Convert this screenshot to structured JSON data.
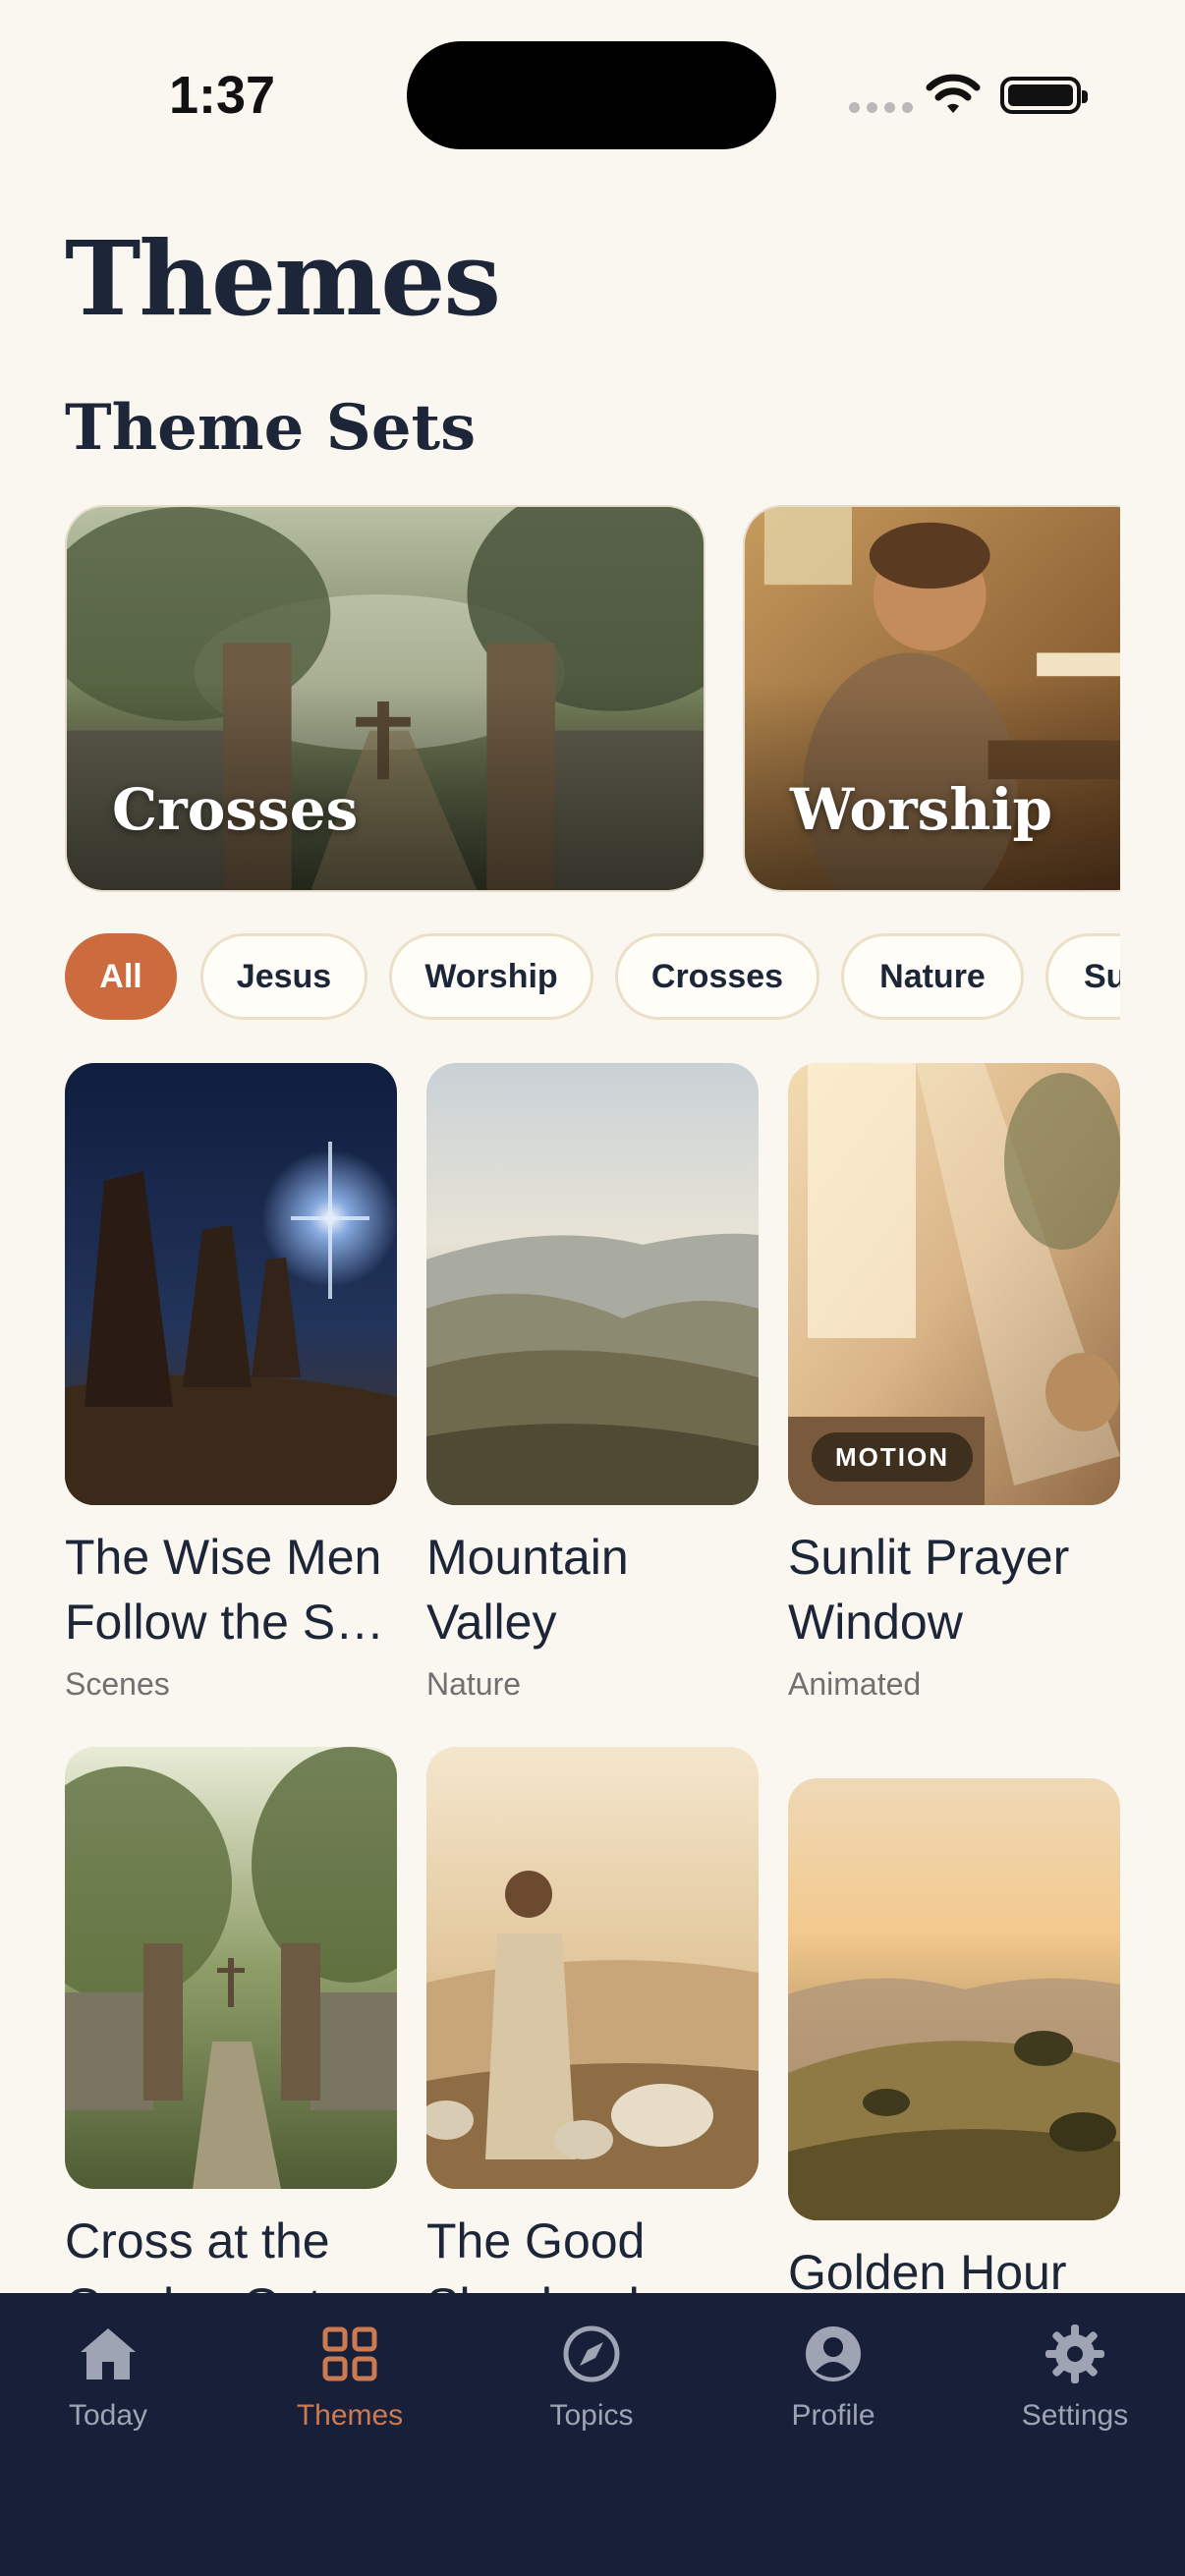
{
  "status_bar": {
    "time": "1:37"
  },
  "page_title": "Themes",
  "theme_sets": {
    "title": "Theme Sets",
    "items": [
      {
        "label": "Crosses"
      },
      {
        "label": "Worship"
      }
    ]
  },
  "filters": {
    "selected": "All",
    "items": [
      "All",
      "Jesus",
      "Worship",
      "Crosses",
      "Nature",
      "Su"
    ]
  },
  "themes": [
    {
      "name": "The Wise Men Follow the S…",
      "category": "Scenes"
    },
    {
      "name": "Mountain Valley",
      "category": "Nature"
    },
    {
      "name": "Sunlit Prayer Window",
      "category": "Animated",
      "badge": "MOTION"
    },
    {
      "name": "Cross at the Garden Gate",
      "category": ""
    },
    {
      "name": "The Good Shepherd",
      "category": ""
    },
    {
      "name": "Golden Hour",
      "category": ""
    }
  ],
  "tab_bar": {
    "selected": "Themes",
    "items": [
      {
        "label": "Today",
        "icon": "house-icon"
      },
      {
        "label": "Themes",
        "icon": "grid-icon"
      },
      {
        "label": "Topics",
        "icon": "compass-icon"
      },
      {
        "label": "Profile",
        "icon": "person-circle-icon"
      },
      {
        "label": "Settings",
        "icon": "gear-icon"
      }
    ]
  },
  "colors": {
    "background": "#faf7f0",
    "accent": "#cc6b3e",
    "text": "#1d2638",
    "tab_bar": "#182039",
    "tab_inactive": "#9ea4b4",
    "tab_active": "#cc7a52"
  }
}
